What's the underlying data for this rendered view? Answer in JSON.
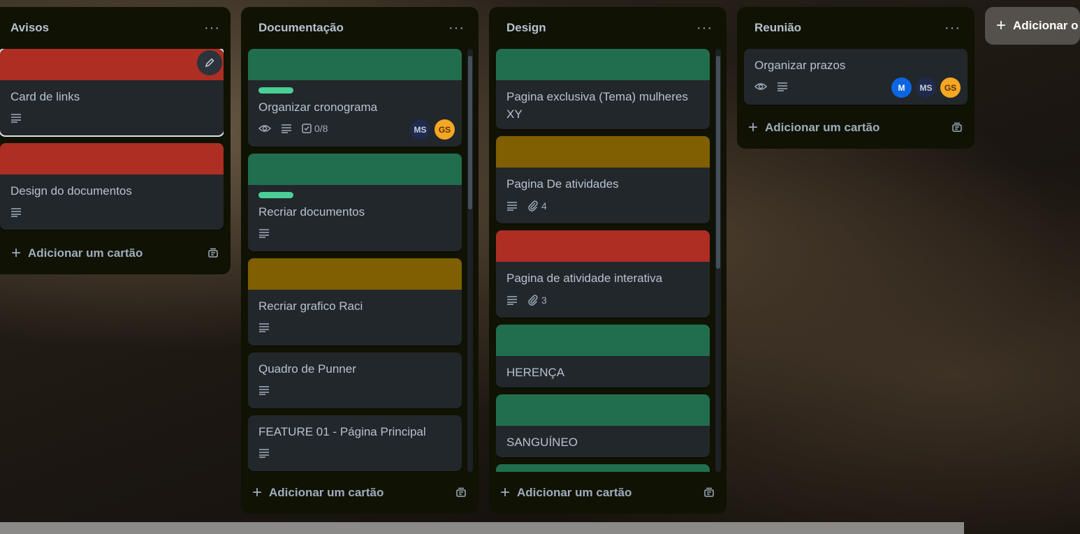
{
  "colors": {
    "list_bg": "#101204",
    "card_bg": "#22272b",
    "red": "#ae2e24",
    "green": "#216e4e",
    "olive": "#7f5f01",
    "label_green": "#4bce97",
    "avatar_ms": "#1f2a4d",
    "avatar_gs": "#f5a623",
    "avatar_m": "#0c66e4"
  },
  "lists": [
    {
      "title": "Avisos",
      "add_label": "Adicionar um cartão",
      "cards": [
        {
          "title": "Card de links",
          "cover": "red",
          "description_icon": "description-icon"
        },
        {
          "title": "Design do documentos",
          "cover": "red",
          "description_icon": "description-icon"
        }
      ]
    },
    {
      "title": "Documentação",
      "add_label": "Adicionar um cartão",
      "cards": [
        {
          "title": "Organizar cronograma",
          "cover": "green",
          "label": "green",
          "checklist": "0/8",
          "members": [
            "MS",
            "GS"
          ]
        },
        {
          "title": "Recriar documentos",
          "cover": "green",
          "label": "green"
        },
        {
          "title": "Recriar grafico Raci",
          "cover": "olive"
        },
        {
          "title": "Quadro de Punner"
        },
        {
          "title": "FEATURE 01 - Página Principal"
        }
      ]
    },
    {
      "title": "Design",
      "add_label": "Adicionar um cartão",
      "cards": [
        {
          "title": "Pagina exclusiva (Tema) mulheres XY",
          "cover": "green"
        },
        {
          "title": "Pagina De atividades",
          "cover": "olive",
          "attachments": "4"
        },
        {
          "title": "Pagina de atividade interativa",
          "cover": "red",
          "attachments": "3"
        },
        {
          "title": "HERENÇA",
          "cover": "green"
        },
        {
          "title": "SANGUÍNEO",
          "cover": "green"
        }
      ]
    },
    {
      "title": "Reunião",
      "add_label": "Adicionar um cartão",
      "cards": [
        {
          "title": "Organizar prazos",
          "members": [
            "M",
            "MS",
            "GS"
          ]
        }
      ]
    }
  ],
  "add_list_label": "Adicionar o",
  "list_menu_glyph": "···"
}
